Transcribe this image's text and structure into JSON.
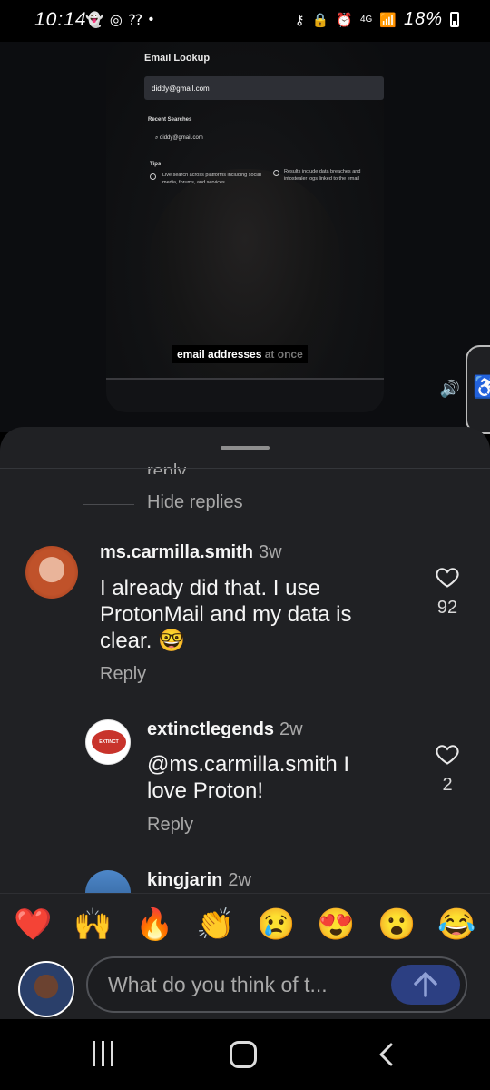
{
  "status_bar": {
    "time": "10:14",
    "battery": "18%",
    "network": "4G"
  },
  "video": {
    "app_title": "Email Lookup",
    "search_value": "diddy@gmail.com",
    "recent_label": "Recent Searches",
    "recent_item": "diddy@gmail.com",
    "tips_label": "Tips",
    "tip1": "Live search across platforms including social media, forums, and services",
    "tip2": "Results include data breaches and infostealer logs linked to the email",
    "caption_main": "email addresses",
    "caption_dim": "at once"
  },
  "comments": {
    "hide_replies": "Hide replies",
    "items": [
      {
        "username": "ms.carmilla.smith",
        "time": "3w",
        "text_line1": "I already did that. I use",
        "text_line2": "ProtonMail and my data is",
        "text_line3": "clear. 🤓",
        "likes": "92",
        "reply": "Reply"
      },
      {
        "username": "extinctlegends",
        "time": "2w",
        "text_line1": "@ms.carmilla.smith I",
        "text_line2": "love Proton!",
        "likes": "2",
        "reply": "Reply",
        "avatar_text": "EXTINCT"
      },
      {
        "username": "kingjarin",
        "time": "2w"
      }
    ]
  },
  "emoji_bar": [
    "❤️",
    "🙌",
    "🔥",
    "👏",
    "😢",
    "😍",
    "😮",
    "😂"
  ],
  "input": {
    "placeholder": "What do you think of t..."
  }
}
